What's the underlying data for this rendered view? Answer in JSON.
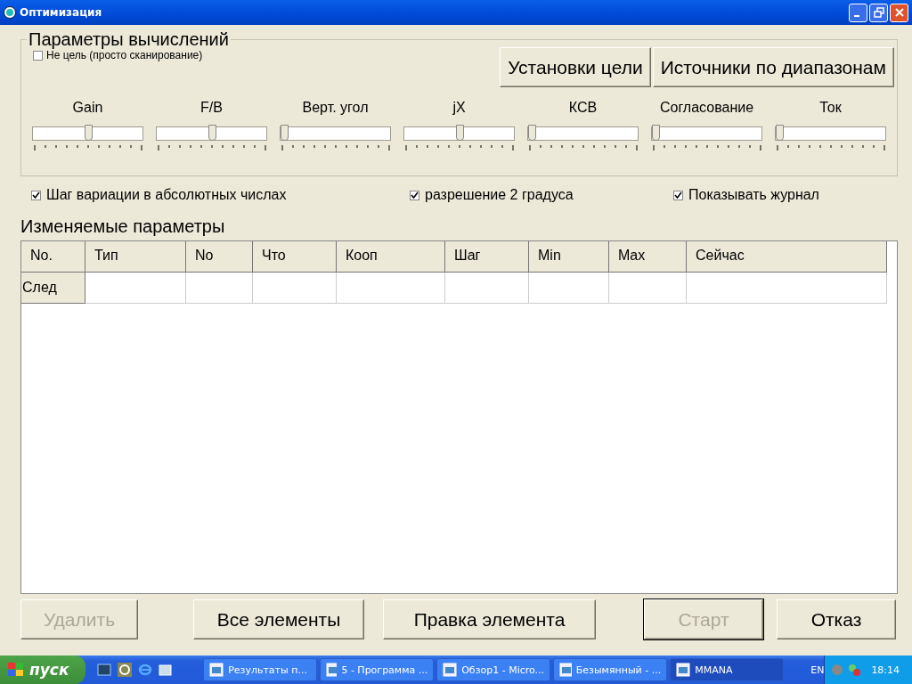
{
  "window": {
    "title": "Оптимизация"
  },
  "params_group": {
    "title": "Параметры вычислений",
    "not_target": {
      "label": "Не цель (просто сканирование)",
      "checked": false
    },
    "buttons": [
      "Установки цели",
      "Источники по диапазонам"
    ],
    "sliders": [
      {
        "label": "Gain",
        "level": 0.5
      },
      {
        "label": "F/B",
        "level": 0.5
      },
      {
        "label": "Верт. угол",
        "level": 0
      },
      {
        "label": "jX",
        "level": 0.5
      },
      {
        "label": "КСВ",
        "level": 0
      },
      {
        "label": "Согласование",
        "level": 0
      },
      {
        "label": "Ток",
        "level": 0
      }
    ]
  },
  "options": [
    {
      "label": "Шаг вариации в абсолютных числах",
      "checked": true
    },
    {
      "label": "разрешение 2 градуса",
      "checked": true
    },
    {
      "label": "Показывать журнал",
      "checked": true
    }
  ],
  "table": {
    "title": "Изменяемые параметры",
    "columns": [
      "No.",
      "Тип",
      "No",
      "Что",
      "Кооп",
      "Шаг",
      "Min",
      "Max",
      "Сейчас"
    ],
    "rows": [
      {
        "label": "След"
      }
    ]
  },
  "buttons": [
    {
      "label": "Удалить",
      "disabled": true
    },
    {
      "label": "Все элементы",
      "disabled": false
    },
    {
      "label": "Правка элемента",
      "disabled": false
    },
    {
      "label": "Старт",
      "disabled": true
    },
    {
      "label": "Отказ",
      "disabled": false
    }
  ],
  "taskbar": {
    "start": "пуск",
    "tasks": [
      {
        "label": "Результаты п...",
        "selected": false
      },
      {
        "label": "5 - Программа ...",
        "selected": false
      },
      {
        "label": "Обзор1 - Micro...",
        "selected": false
      },
      {
        "label": "Безымянный - ...",
        "selected": false
      },
      {
        "label": "MMANA",
        "selected": true
      }
    ],
    "language": "EN",
    "clock": "18:14"
  }
}
